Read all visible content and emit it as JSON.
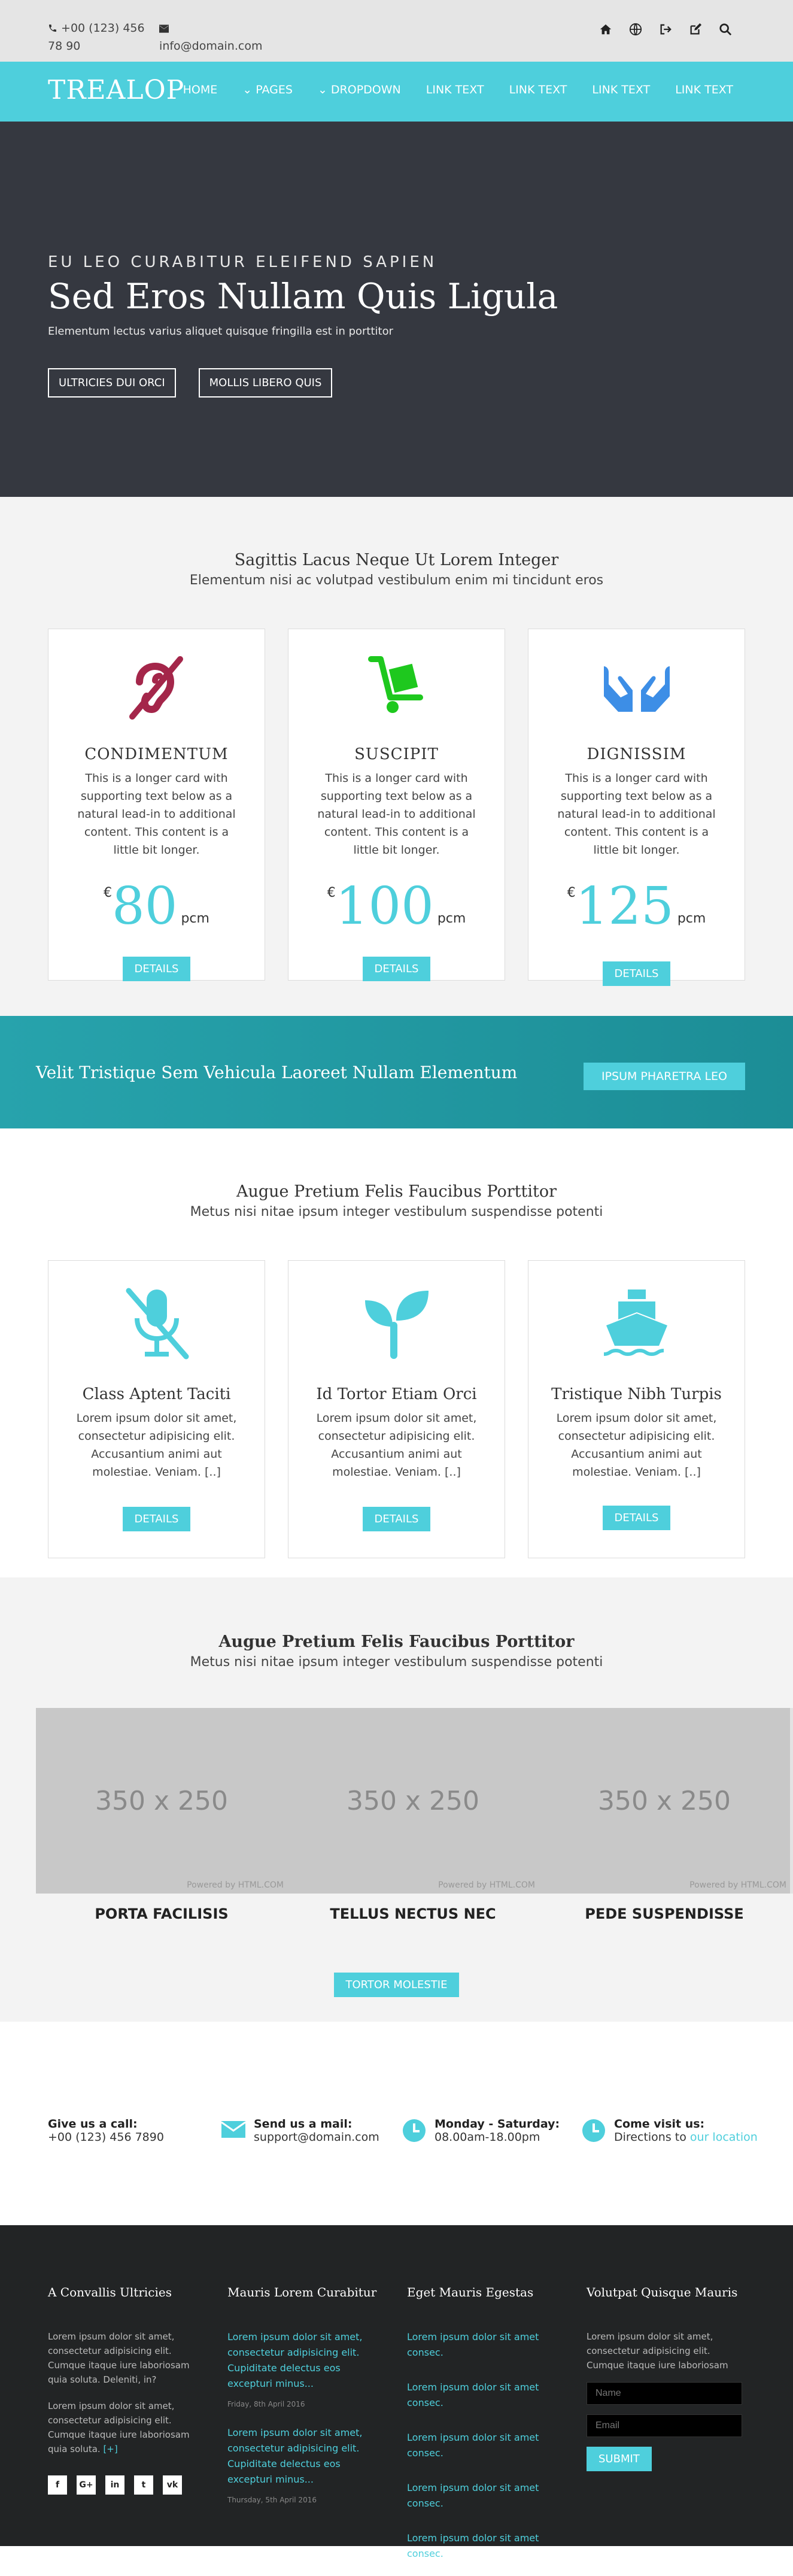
{
  "topbar": {
    "phone": "+00 (123) 456 78 90",
    "email": "info@domain.com"
  },
  "nav": {
    "brand": "TREALOP",
    "items": [
      "HOME",
      "PAGES",
      "DROPDOWN",
      "LINK TEXT",
      "LINK TEXT",
      "LINK TEXT",
      "LINK TEXT"
    ]
  },
  "hero": {
    "eyebrow": "EU LEO CURABITUR ELEIFEND SAPIEN",
    "title": "Sed Eros Nullam Quis Ligula",
    "lead": "Elementum lectus varius aliquet quisque fringilla est in porttitor",
    "btn1": "ULTRICIES DUI ORCI",
    "btn2": "MOLLIS LIBERO QUIS"
  },
  "pricing": {
    "title": "Sagittis Lacus Neque Ut Lorem Integer",
    "subtitle": "Elementum nisi ac volutpad vestibulum enim mi tincidunt eros",
    "cards": [
      {
        "title": "CONDIMENTUM",
        "text": "This is a longer card with supporting text below as a natural lead-in to additional content. This content is a little bit longer.",
        "currency": "€",
        "amount": "80",
        "unit": "pcm",
        "button": "DETAILS",
        "icon": "hearing-impaired-icon",
        "color": "#a4264a"
      },
      {
        "title": "SUSCIPIT",
        "text": "This is a longer card with supporting text below as a natural lead-in to additional content. This content is a little bit longer.",
        "currency": "€",
        "amount": "100",
        "unit": "pcm",
        "button": "DETAILS",
        "icon": "hand-truck-icon",
        "color": "#1ec81e"
      },
      {
        "title": "DIGNISSIM",
        "text": "This is a longer card with supporting text below as a natural lead-in to additional content. This content is a little bit longer.",
        "currency": "€",
        "amount": "125",
        "unit": "pcm",
        "button": "DETAILS",
        "icon": "open-hands-icon",
        "color": "#3d8ee6"
      }
    ]
  },
  "banner": {
    "text": "Velit Tristique Sem Vehicula Laoreet Nullam Elementum",
    "button": "IPSUM PHARETRA LEO"
  },
  "features": {
    "title": "Augue Pretium Felis Faucibus Porttitor",
    "subtitle": "Metus nisi nitae ipsum integer vestibulum suspendisse potenti",
    "cards": [
      {
        "title": "Class Aptent Taciti",
        "text": "Lorem ipsum dolor sit amet, consectetur adipisicing elit. Accusantium animi aut molestiae. Veniam. [..]",
        "button": "DETAILS"
      },
      {
        "title": "Id Tortor Etiam Orci",
        "text": "Lorem ipsum dolor sit amet, consectetur adipisicing elit. Accusantium animi aut molestiae. Veniam. [..]",
        "button": "DETAILS"
      },
      {
        "title": "Tristique Nibh Turpis",
        "text": "Lorem ipsum dolor sit amet, consectetur adipisicing elit. Accusantium animi aut molestiae. Veniam. [..]",
        "button": "DETAILS"
      }
    ]
  },
  "gallery": {
    "title": "Augue Pretium Felis Faucibus Porttitor",
    "subtitle": "Metus nisi nitae ipsum integer vestibulum suspendisse potenti",
    "placeholder": "350 x 250",
    "powered": "Powered by HTML.COM",
    "captions": [
      "PORTA FACILISIS",
      "TELLUS NECTUS NEC",
      "PEDE SUSPENDISSE"
    ],
    "button": "TORTOR MOLESTIE"
  },
  "contact": {
    "call_label": "Give us a call:",
    "call_value": "+00 (123) 456 7890",
    "mail_label": "Send us a mail:",
    "mail_value": "support@domain.com",
    "hours_label": "Monday - Saturday:",
    "hours_value": "08.00am-18.00pm",
    "visit_label": "Come visit us:",
    "visit_value": "Directions to",
    "visit_link": "our location"
  },
  "footer": {
    "col1": {
      "title": "A Convallis Ultricies",
      "p1": "Lorem ipsum dolor sit amet, consectetur adipisicing elit. Cumque itaque iure laboriosam quia soluta. Deleniti, in?",
      "p2": "Lorem ipsum dolor sit amet, consectetur adipisicing elit. Cumque itaque iure laboriosam quia soluta.",
      "p2_link": "[+]"
    },
    "col2": {
      "title": "Mauris Lorem Curabitur",
      "post1": "Lorem ipsum dolor sit amet, consectetur adipisicing elit. Cupiditate delectus eos excepturi minus...",
      "date1": "Friday, 8th April 2016",
      "post2": "Lorem ipsum dolor sit amet, consectetur adipisicing elit. Cupiditate delectus eos excepturi minus...",
      "date2": "Thursday, 5th April 2016"
    },
    "col3": {
      "title": "Eget Mauris Egestas",
      "links": [
        "Lorem ipsum dolor sit amet consec.",
        "Lorem ipsum dolor sit amet consec.",
        "Lorem ipsum dolor sit amet consec.",
        "Lorem ipsum dolor sit amet consec.",
        "Lorem ipsum dolor sit amet consec."
      ]
    },
    "col4": {
      "title": "Volutpat Quisque Mauris",
      "text": "Lorem ipsum dolor sit amet, consectetur adipisicing elit. Cumque itaque iure laboriosam",
      "name_placeholder": "Name",
      "email_placeholder": "Email",
      "button": "SUBMIT"
    }
  },
  "colors": {
    "accent": "#4ecfdc",
    "hero_bg": "#353840",
    "banner_bg": "#27a3ac",
    "footer_bg": "#222425"
  }
}
